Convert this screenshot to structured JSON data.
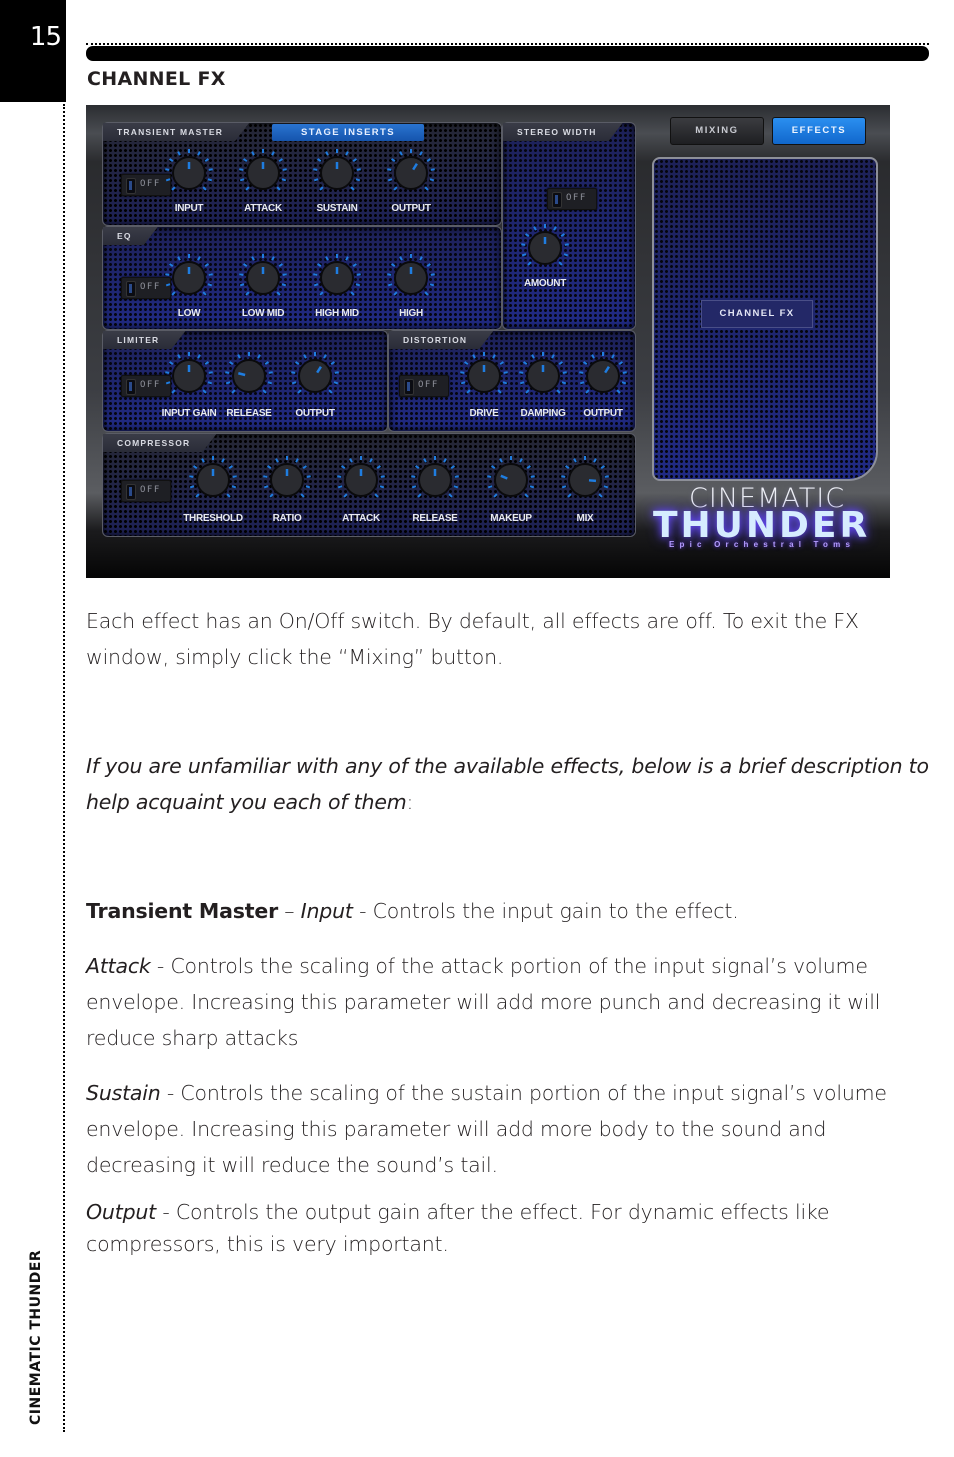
{
  "page": {
    "number": "15",
    "side_title": "CINEMATIC THUNDER",
    "section_title": "CHANNEL FX"
  },
  "plugin": {
    "stage_inserts_label": "STAGE INSERTS",
    "tabs": [
      {
        "label": "MIXING",
        "active": false
      },
      {
        "label": "EFFECTS",
        "active": true
      }
    ],
    "channel_fx_button": "CHANNEL FX",
    "logo": {
      "line1": "CINEMATIC",
      "line2": "THUNDER",
      "tagline": "Epic Orchestral Toms"
    },
    "accent_color": "#1f7de0",
    "panels": {
      "transient_master": {
        "title": "TRANSIENT MASTER",
        "toggle": "OFF",
        "knobs": [
          {
            "label": "INPUT",
            "value": 0.5
          },
          {
            "label": "ATTACK",
            "value": 0.5
          },
          {
            "label": "SUSTAIN",
            "value": 0.5
          },
          {
            "label": "OUTPUT",
            "value": 0.62
          }
        ]
      },
      "stereo_width": {
        "title": "STEREO WIDTH",
        "toggle": "OFF",
        "knobs": [
          {
            "label": "AMOUNT",
            "value": 0.5
          }
        ]
      },
      "eq": {
        "title": "EQ",
        "toggle": "OFF",
        "knobs": [
          {
            "label": "LOW",
            "value": 0.5
          },
          {
            "label": "LOW MID",
            "value": 0.5
          },
          {
            "label": "HIGH MID",
            "value": 0.5
          },
          {
            "label": "HIGH",
            "value": 0.5
          }
        ]
      },
      "limiter": {
        "title": "LIMITER",
        "toggle": "OFF",
        "knobs": [
          {
            "label": "INPUT GAIN",
            "value": 0.5
          },
          {
            "label": "RELEASE",
            "value": 0.22
          },
          {
            "label": "OUTPUT",
            "value": 0.62
          }
        ]
      },
      "distortion": {
        "title": "DISTORTION",
        "toggle": "OFF",
        "knobs": [
          {
            "label": "DRIVE",
            "value": 0.5
          },
          {
            "label": "DAMPING",
            "value": 0.5
          },
          {
            "label": "OUTPUT",
            "value": 0.62
          }
        ]
      },
      "compressor": {
        "title": "COMPRESSOR",
        "toggle": "OFF",
        "knobs": [
          {
            "label": "THRESHOLD",
            "value": 0.5
          },
          {
            "label": "RATIO",
            "value": 0.5
          },
          {
            "label": "ATTACK",
            "value": 0.5
          },
          {
            "label": "RELEASE",
            "value": 0.5
          },
          {
            "label": "MAKEUP",
            "value": 0.25
          },
          {
            "label": "MIX",
            "value": 0.85
          }
        ]
      }
    }
  },
  "text": {
    "intro_p1": "Each effect has an On/Off switch. By default, all effects are off. To exit the FX window, simply click the “Mixing” button.",
    "intro_p2_italic": "If you are unfamiliar with any of the available effects, below is a brief description to help acquaint you each of them",
    "intro_p2_tail": ":",
    "tm_bold": "Transient Master",
    "tm_dash": " – ",
    "tm_input_italic": "Input",
    "tm_input_desc": " - Controls the input gain to the effect.",
    "attack_italic": "Attack",
    "attack_desc": " - Controls the scaling of the attack portion of the input signal’s volume envelope. Increasing this parameter will add more punch and decreasing it will reduce sharp attacks",
    "sustain_italic": "Sustain",
    "sustain_desc": " - Controls the scaling of the sustain portion of the input signal’s volume envelope. Increasing this parameter will add more body to the sound and decreasing it will reduce the sound’s tail.",
    "output_italic": "Output",
    "output_desc": " - Controls the output gain after the effect. For dynamic effects like compressors, this is very important."
  }
}
